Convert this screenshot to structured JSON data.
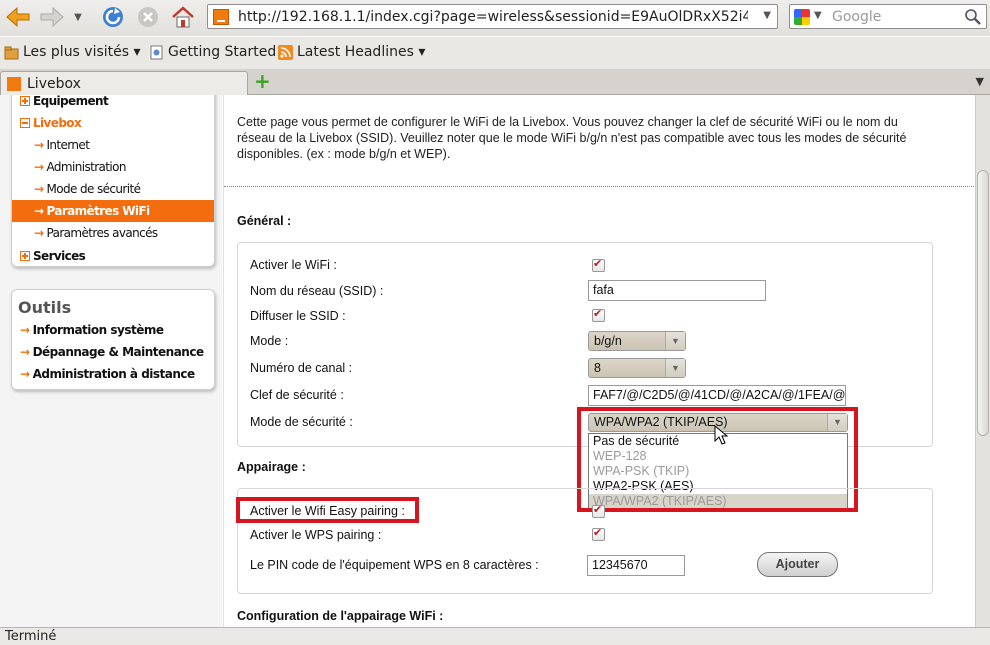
{
  "browser": {
    "url": "http://192.168.1.1/index.cgi?page=wireless&sessionid=E9AuOlDRxX52i4XvM",
    "search_placeholder": "Google",
    "bookmarks": [
      "Les plus visités ▾",
      "Getting Started",
      "Latest Headlines ▾"
    ],
    "tab_title": "Livebox",
    "status": "Terminé"
  },
  "sidebar": {
    "items": [
      {
        "label": "Equipement"
      },
      {
        "label": "Livebox"
      },
      {
        "label": "Internet"
      },
      {
        "label": "Administration"
      },
      {
        "label": "Mode de sécurité"
      },
      {
        "label": "Paramètres WiFi"
      },
      {
        "label": "Paramètres avancés"
      },
      {
        "label": "Services"
      }
    ],
    "tools_title": "Outils",
    "tools": [
      "Information système",
      "Dépannage & Maintenance",
      "Administration à distance"
    ]
  },
  "main": {
    "intro": "Cette page vous permet de configurer le WiFi de la Livebox. Vous pouvez changer la clef de sécurité WiFi ou le nom du réseau de la Livebox (SSID). Veuillez noter que le mode WiFi b/g/n n'est pas compatible avec tous les modes de sécurité disponibles. (ex : mode b/g/n et WEP).",
    "general_title": "Général :",
    "fields": {
      "wifi_label": "Activer le WiFi :",
      "ssid_label": "Nom du réseau (SSID) :",
      "ssid_value": "fafa",
      "broadcast_label": "Diffuser le SSID :",
      "mode_label": "Mode :",
      "mode_value": "b/g/n",
      "channel_label": "Numéro de canal :",
      "channel_value": "8",
      "key_label": "Clef de sécurité :",
      "key_value": "FAF7/@/C2D5/@/41CD/@/A2CA/@/1FEA/@",
      "security_label": "Mode de sécurité :",
      "security_value": "WPA/WPA2 (TKIP/AES)"
    },
    "security_options": [
      {
        "label": "Pas de sécurité",
        "state": "enabled"
      },
      {
        "label": "WEP-128",
        "state": "disabled"
      },
      {
        "label": "WPA-PSK (TKIP)",
        "state": "disabled"
      },
      {
        "label": "WPA2-PSK (AES)",
        "state": "enabled"
      },
      {
        "label": "WPA/WPA2 (TKIP/AES)",
        "state": "selected"
      }
    ],
    "pairing_title": "Appairage :",
    "pairing": {
      "easy_label": "Activer le Wifi Easy pairing :",
      "wps_label": "Activer le WPS pairing :",
      "pin_label": "Le PIN code de l'équipement WPS en 8 caractères :",
      "pin_value": "12345670",
      "add_button": "Ajouter"
    },
    "config_title": "Configuration de l'appairage WiFi :"
  },
  "colors": {
    "accent": "#f36d0e",
    "highlight_box": "#d8141e",
    "checkmark": "#c8161d"
  }
}
